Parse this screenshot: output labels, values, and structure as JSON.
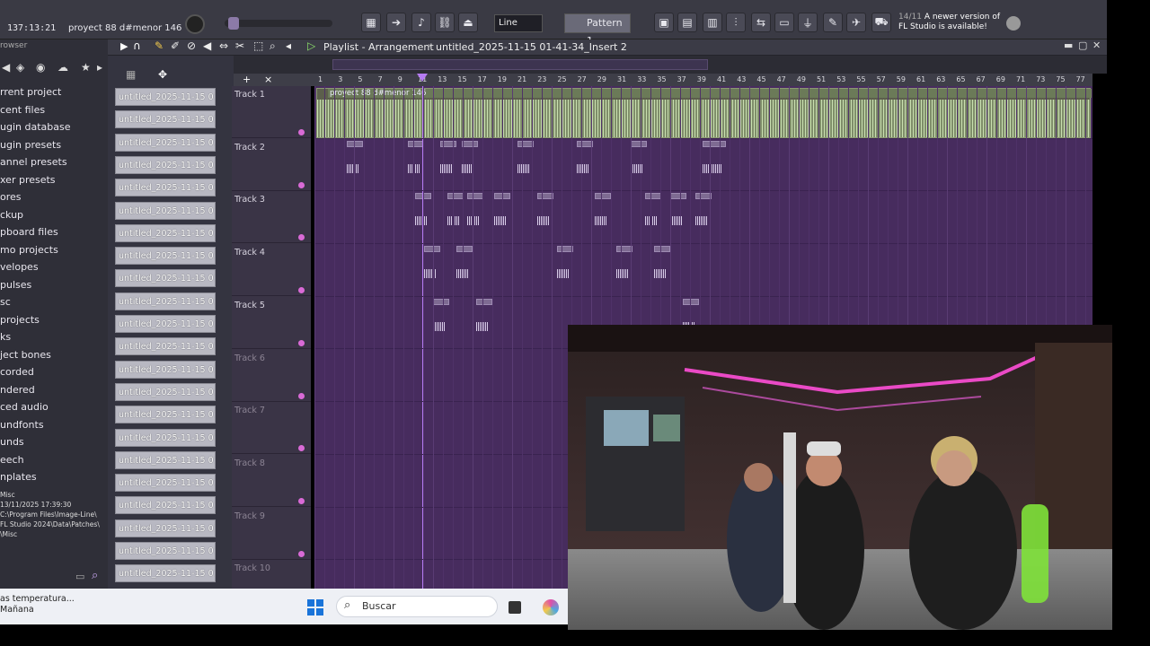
{
  "topbar": {
    "time": "137:13:21",
    "project_hint": "proyect 88 d#menor 146",
    "pattern_label": "Pattern 1",
    "snap_label": "Line",
    "notice_date": "14/11",
    "notice_text": "A newer version of FL Studio is available!"
  },
  "browser": {
    "title": "rowser",
    "items": [
      "rrent project",
      "cent files",
      "ugin database",
      "ugin presets",
      "annel presets",
      "xer presets",
      "ores",
      "ckup",
      "pboard files",
      "mo projects",
      "velopes",
      "pulses",
      "sc",
      "projects",
      "ks",
      "ject bones",
      "corded",
      "ndered",
      "ced audio",
      "undfonts",
      "unds",
      "eech",
      "nplates"
    ],
    "hint_lines": [
      "Misc",
      "13/11/2025 17:39:30",
      "C:\\Program Files\\Image-Line\\",
      "FL Studio 2024\\Data\\Patches\\",
      "\\Misc"
    ]
  },
  "playlist": {
    "title": "Playlist - Arrangement",
    "crumb": "untitled_2025-11-15 01-41-34_Insert 2",
    "clip_title": "proyect 88 d#menor 146",
    "tracks": [
      "Track 1",
      "Track 2",
      "Track 3",
      "Track 4",
      "Track 5",
      "Track 6",
      "Track 7",
      "Track 8",
      "Track 9",
      "Track 10"
    ],
    "ruler": [
      "1",
      "3",
      "5",
      "7",
      "9",
      "11",
      "13",
      "15",
      "17",
      "19",
      "21",
      "23",
      "25",
      "27",
      "29",
      "31",
      "33",
      "35",
      "37",
      "39",
      "41",
      "43",
      "45",
      "47",
      "49",
      "51",
      "53",
      "55",
      "57",
      "59",
      "61",
      "63",
      "65",
      "67",
      "69",
      "71",
      "73",
      "75",
      "77"
    ],
    "patterns": [
      "untitled_2025-11-15 01-...",
      "untitled_2025-11-15 01-...",
      "untitled_2025-11-15 01-...",
      "untitled_2025-11-15 01-...",
      "untitled_2025-11-15 01-...",
      "untitled_2025-11-15 01-...",
      "untitled_2025-11-15 01-...",
      "untitled_2025-11-15 01-...",
      "untitled_2025-11-15 01-...",
      "untitled_2025-11-15 01-...",
      "untitled_2025-11-15 01-...",
      "untitled_2025-11-15 01-...",
      "untitled_2025-11-15 01-...",
      "untitled_2025-11-15 01-...",
      "untitled_2025-11-15 01-...",
      "untitled_2025-11-15 01-...",
      "untitled_2025-11-15 01-...",
      "untitled_2025-11-15 01-...",
      "untitled_2025-11-15 01-...",
      "untitled_2025-11-15 01-...",
      "untitled_2025-11-15 01-...",
      "untitled_2025-11-15 01-..."
    ]
  },
  "taskbar": {
    "weather_line1": "as temperatura...",
    "weather_line2": "Mañana",
    "search_placeholder": "Buscar"
  },
  "colors": {
    "grid": "#472c5e",
    "waveform": "#c9dfb0",
    "accent": "#b57bf2"
  }
}
